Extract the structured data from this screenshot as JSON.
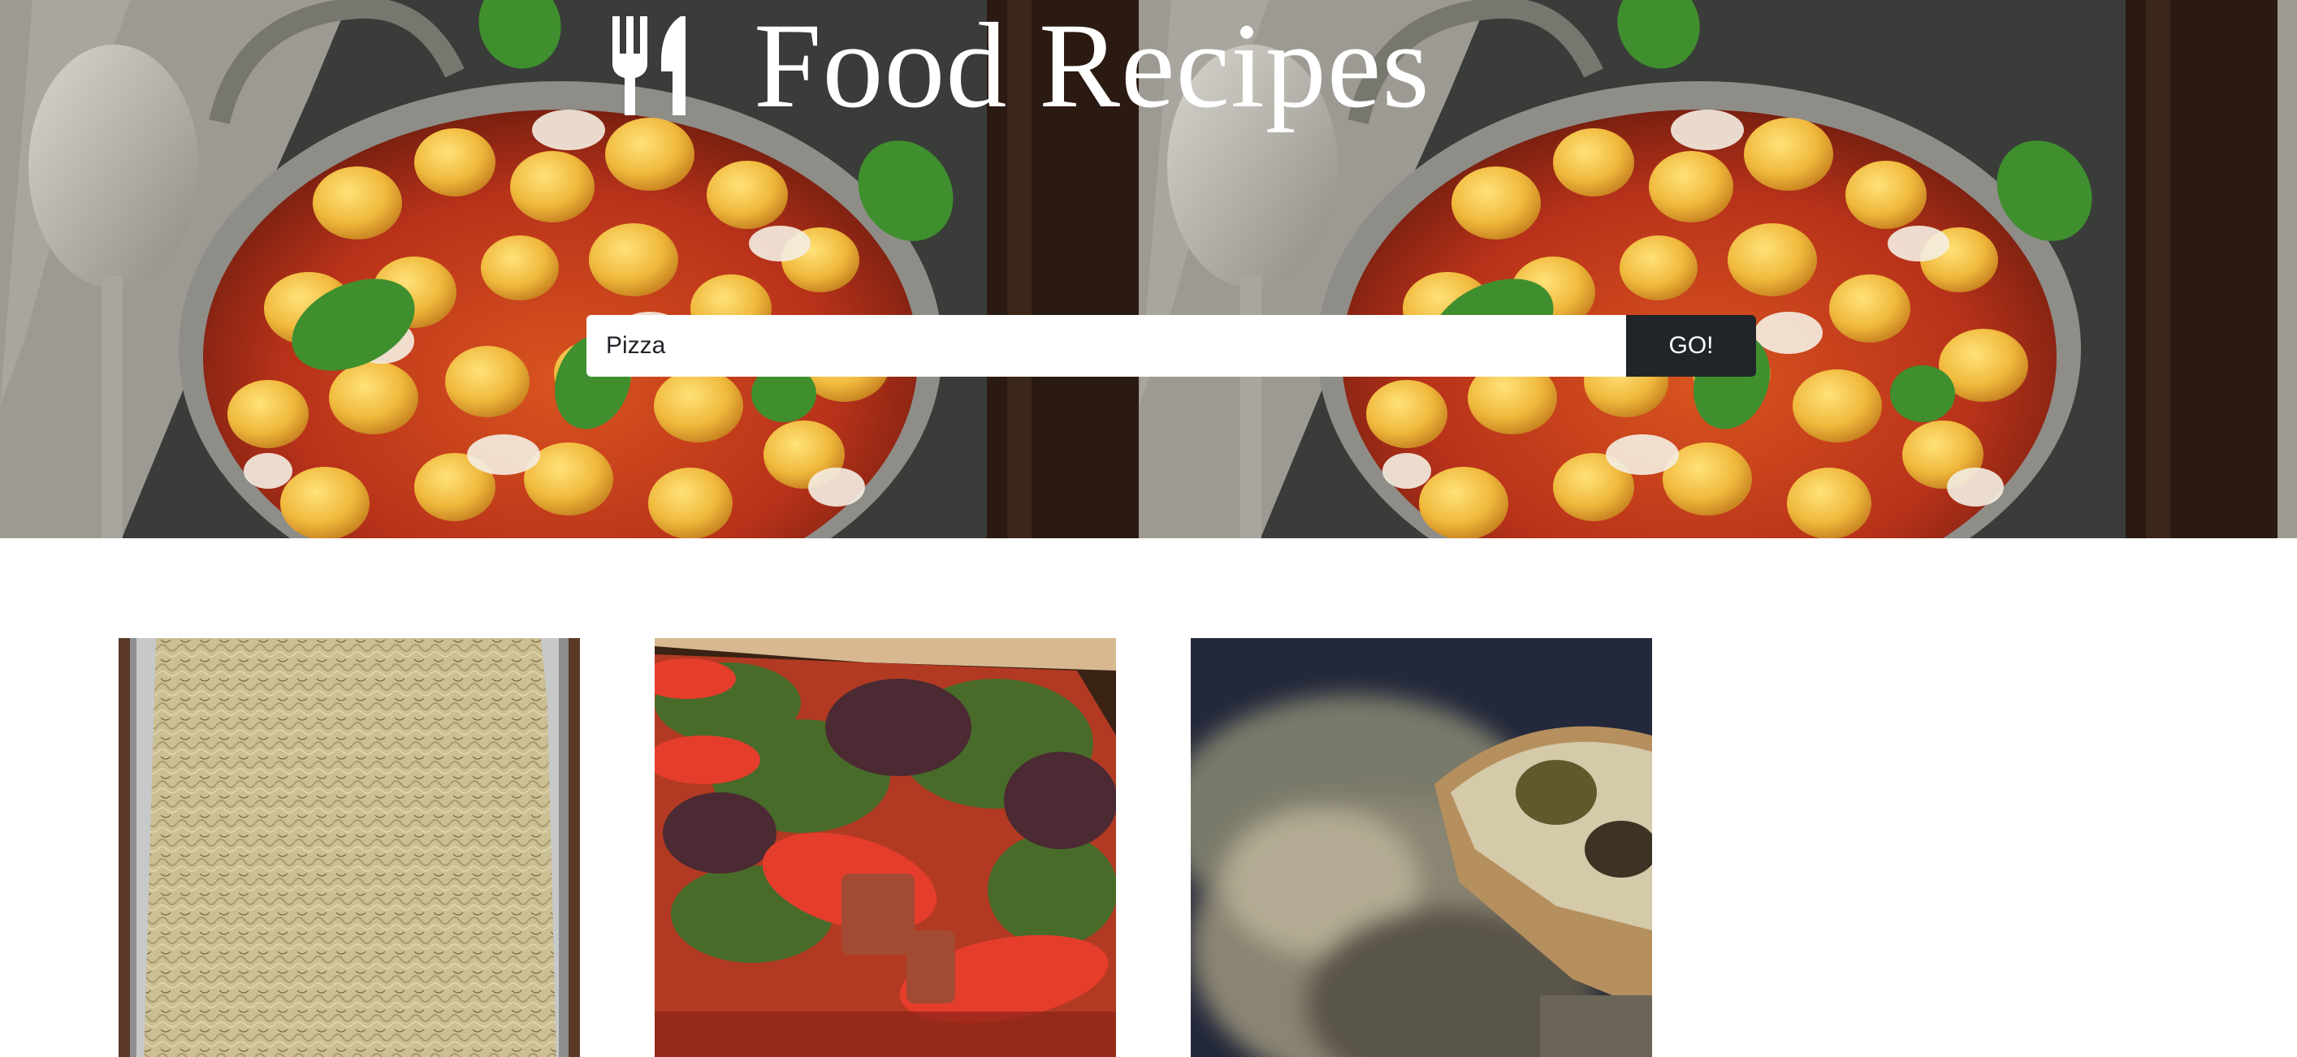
{
  "header": {
    "title": "Food Recipes",
    "logo_icon": "fork-knife-icon"
  },
  "search": {
    "value": "Pizza",
    "placeholder": "",
    "button_label": "GO!"
  },
  "results": [
    {
      "image": "onion-flatbread-pizza"
    },
    {
      "image": "blt-pizza"
    },
    {
      "image": "eggplant-pizza"
    }
  ],
  "colors": {
    "button_bg": "#212529",
    "button_text": "#ffffff",
    "title_text": "#ffffff",
    "page_bg": "#ffffff"
  }
}
